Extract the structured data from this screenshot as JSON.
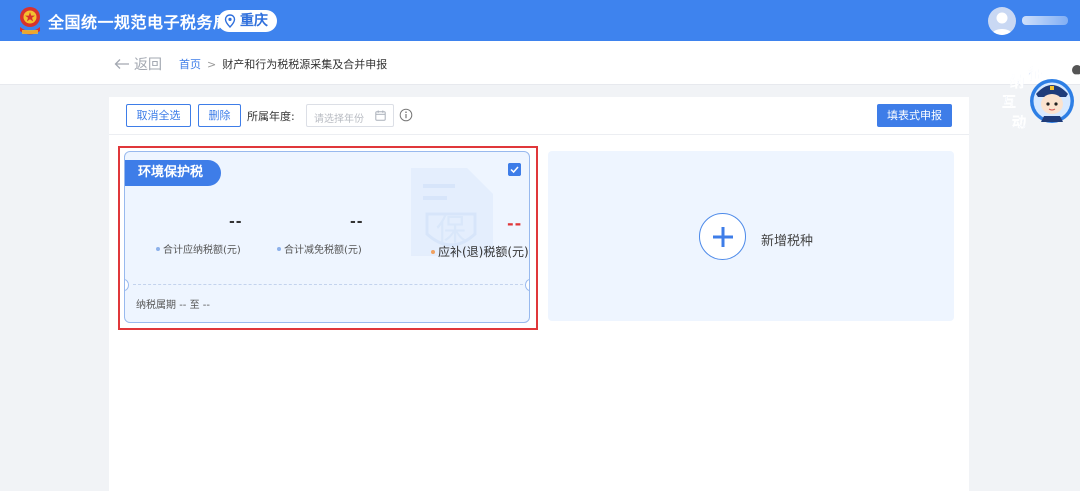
{
  "header": {
    "site_title": "全国统一规范电子税务局",
    "region": "重庆"
  },
  "breadcrumb": {
    "back_label": "返回",
    "home": "首页",
    "separator": ">",
    "current": "财产和行为税税源采集及合并申报"
  },
  "toolbar": {
    "deselect_all_label": "取消全选",
    "delete_label": "删除",
    "year_label": "所属年度:",
    "year_placeholder": "请选择年份",
    "fill_form_label": "填表式申报"
  },
  "tax_card": {
    "name": "环境保护税",
    "selected": true,
    "total_payable": {
      "value": "--",
      "label": "合计应纳税额(元)"
    },
    "total_reduction": {
      "value": "--",
      "label": "合计减免税额(元)"
    },
    "refund": {
      "value": "--",
      "label": "应补(退)税额(元)"
    },
    "period_label": "纳税属期",
    "period_value": "-- 至 --",
    "watermark_char": "保"
  },
  "add_card": {
    "label": "新增税种"
  },
  "mascot": {
    "text_lines": [
      "征",
      "纳",
      "互",
      "动"
    ]
  },
  "colors": {
    "primary": "#3e83ee",
    "accent_red": "#e0373a",
    "card_bg": "#eef5ff"
  },
  "icons": [
    "emblem-icon",
    "location-pin-icon",
    "avatar-icon",
    "back-arrow-icon",
    "calendar-icon",
    "info-icon",
    "checkbox-checked-icon",
    "plus-icon",
    "document-watermark-icon",
    "mascot-icon",
    "close-icon"
  ]
}
